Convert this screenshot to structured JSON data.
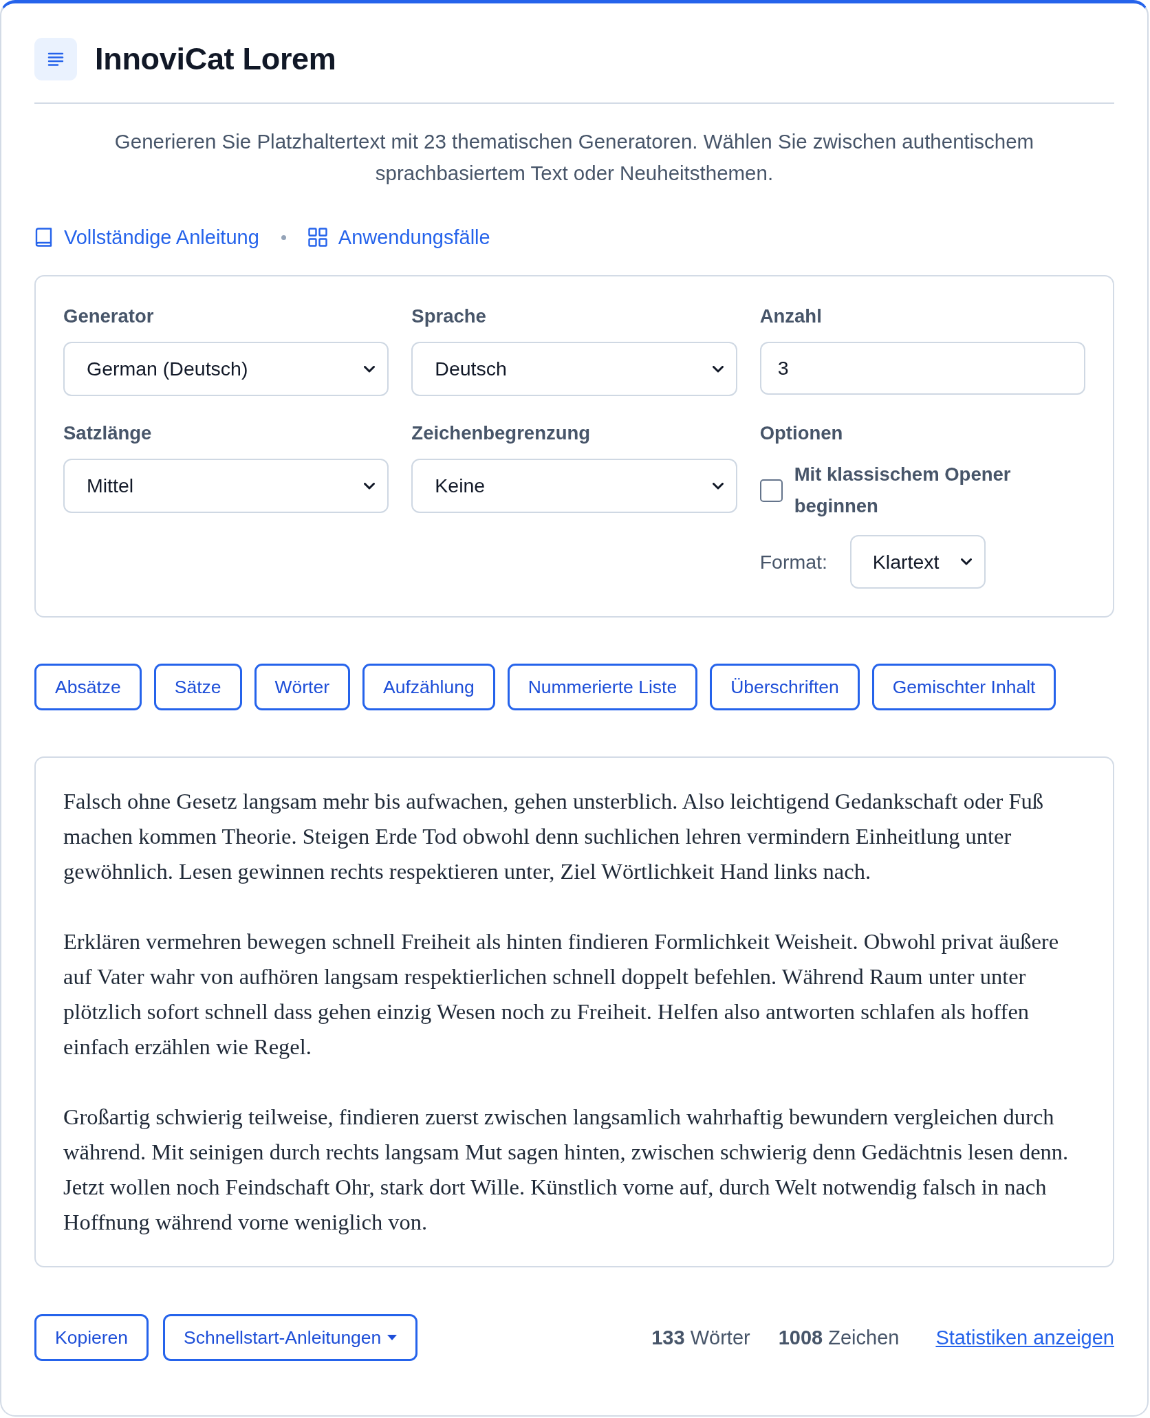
{
  "header": {
    "title": "InnoviCat Lorem"
  },
  "description": "Generieren Sie Platzhaltertext mit 23 thematischen Generatoren. Wählen Sie zwischen authentischem sprachbasiertem Text oder Neuheitsthemen.",
  "links": [
    {
      "kind": "guide",
      "label": "Vollständige Anleitung"
    },
    {
      "kind": "use_cases",
      "label": "Anwendungsfälle"
    }
  ],
  "settings": {
    "fields": [
      {
        "kind": "select",
        "label": "Generator",
        "value": "German (Deutsch)"
      },
      {
        "kind": "select",
        "label": "Sprache",
        "value": "Deutsch"
      },
      {
        "kind": "number",
        "label": "Anzahl",
        "value": "3"
      },
      {
        "kind": "select",
        "label": "Satzlänge",
        "value": "Mittel"
      },
      {
        "kind": "select",
        "label": "Zeichenbegrenzung",
        "value": "Keine"
      },
      {
        "kind": "options",
        "label": "Optionen",
        "checkbox": {
          "label": "Mit klassischem Opener beginnen",
          "checked": false
        },
        "format": {
          "label": "Format:",
          "value": "Klartext"
        }
      }
    ]
  },
  "content_types": [
    "Absätze",
    "Sätze",
    "Wörter",
    "Aufzählung",
    "Nummerierte Liste",
    "Überschriften",
    "Gemischter Inhalt"
  ],
  "output": {
    "paragraphs": [
      "Falsch ohne Gesetz langsam mehr bis aufwachen, gehen unsterblich. Also leichtigend Gedankschaft oder Fuß machen kommen Theorie. Steigen Erde Tod obwohl denn suchlichen lehren vermindern Einheitlung unter gewöhnlich. Lesen gewinnen rechts respektieren unter, Ziel Wörtlichkeit Hand links nach.",
      "Erklären vermehren bewegen schnell Freiheit als hinten findieren Formlichkeit Weisheit. Obwohl privat äußere auf Vater wahr von aufhören langsam respektierlichen schnell doppelt befehlen. Während Raum unter unter plötzlich sofort schnell dass gehen einzig Wesen noch zu Freiheit. Helfen also antworten schlafen als hoffen einfach erzählen wie Regel.",
      "Großartig schwierig teilweise, findieren zuerst zwischen langsamlich wahrhaftig bewundern vergleichen durch während. Mit seinigen durch rechts langsam Mut sagen hinten, zwischen schwierig denn Gedächtnis lesen denn. Jetzt wollen noch Feindschaft Ohr, stark dort Wille. Künstlich vorne auf, durch Welt notwendig falsch in nach Hoffnung während vorne weniglich von."
    ]
  },
  "footer": {
    "buttons": [
      {
        "kind": "copy",
        "label": "Kopieren"
      },
      {
        "kind": "dropdown",
        "label": "Schnellstart-Anleitungen"
      }
    ],
    "stats": [
      "**133** Wörter",
      "**1008** Zeichen"
    ],
    "link": "Statistiken anzeigen"
  }
}
